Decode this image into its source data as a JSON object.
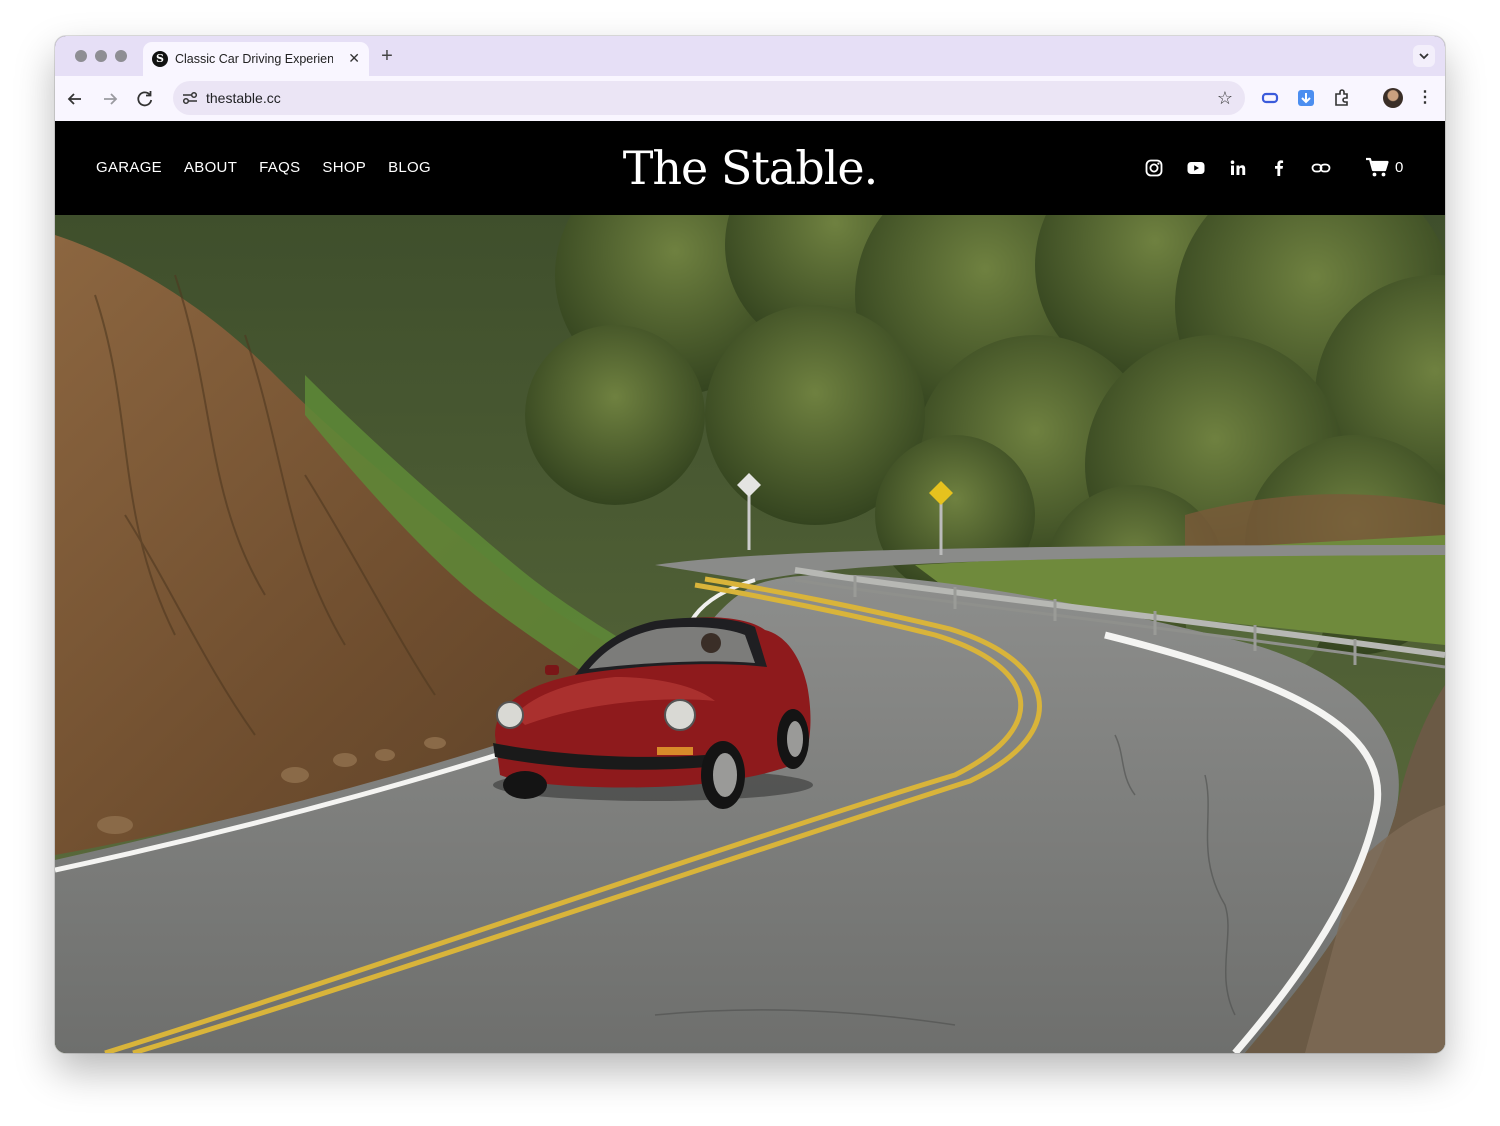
{
  "browser": {
    "tab": {
      "title": "Classic Car Driving Experienc",
      "favicon_letter": "S"
    },
    "newtab_symbol": "+",
    "close_symbol": "✕",
    "url": "thestable.cc",
    "icons": [
      "back-icon",
      "forward-icon",
      "reload-icon",
      "site-info-icon",
      "star-icon",
      "extension-icon",
      "download-icon",
      "puzzle-icon",
      "avatar",
      "more-menu-icon"
    ]
  },
  "site": {
    "nav": [
      "GARAGE",
      "ABOUT",
      "FAQS",
      "SHOP",
      "BLOG"
    ],
    "logo": "The Stable.",
    "social_icons": [
      "instagram-icon",
      "youtube-icon",
      "linkedin-icon",
      "facebook-icon",
      "link-icon"
    ],
    "cart_count": "0"
  },
  "colors": {
    "tabstrip": "#e6dff6",
    "header": "#000000",
    "car": "#8e1a1c",
    "road_line": "#d9b43a"
  }
}
